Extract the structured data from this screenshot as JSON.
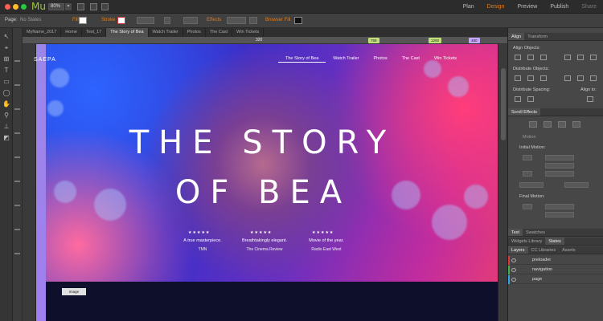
{
  "app": {
    "name": "Mu",
    "zoom": "80%",
    "modes": [
      "Plan",
      "Design",
      "Preview",
      "Publish",
      "Share"
    ],
    "active_mode": "Design"
  },
  "control_bar": {
    "page_label": "Page:",
    "page_value": "No States",
    "fill_label": "Fill",
    "stroke_label": "Stroke",
    "effects_label": "Effects",
    "browser_fill_label": "Browser Fill"
  },
  "doc_tabs": [
    "MyName_2017",
    "Home",
    "Test_17",
    "The Story of Bea",
    "Watch Trailer",
    "Photos",
    "The Cast",
    "Win Tickets"
  ],
  "active_doc_tab": "The Story of Bea",
  "ruler": {
    "mid": "320",
    "markers": [
      "768",
      "1200",
      "480"
    ]
  },
  "site": {
    "logo": "SAEPA",
    "nav": [
      "The Story of Bea",
      "Watch Trailer",
      "Photos",
      "The Cast",
      "Win Tickets"
    ],
    "title_line1": "THE STORY",
    "title_line2": "OF BEA",
    "reviews": [
      {
        "stars": "★★★★★",
        "quote": "A true masterpiece.",
        "source": "TMN"
      },
      {
        "stars": "★★★★★",
        "quote": "Breathtakingly elegant.",
        "source": "The Cinema Review"
      },
      {
        "stars": "★★★★★",
        "quote": "Movie of the year.",
        "source": "Radio East West"
      }
    ],
    "element_tag": "image"
  },
  "right_panel": {
    "tabs_top": [
      "Align",
      "Transform"
    ],
    "align_objects": "Align Objects:",
    "distribute_objects": "Distribute Objects:",
    "distribute_spacing": "Distribute Spacing:",
    "align_to": "Align to:",
    "scroll_effects": "Scroll Effects",
    "motion": "Motion",
    "initial_motion": "Initial Motion:",
    "final_motion": "Final Motion:",
    "tabs_mid": [
      "Text",
      "Swatches"
    ],
    "tabs_mid2": [
      "Widgets Library",
      "States"
    ],
    "tabs_layers": [
      "Layers",
      "CC Libraries",
      "Assets"
    ],
    "layers": [
      "preloader",
      "navigation",
      "page"
    ]
  },
  "colors": {
    "accent_orange": "#e47c17",
    "app_green": "#9fc93c",
    "guide_purple": "#a07ff0"
  }
}
